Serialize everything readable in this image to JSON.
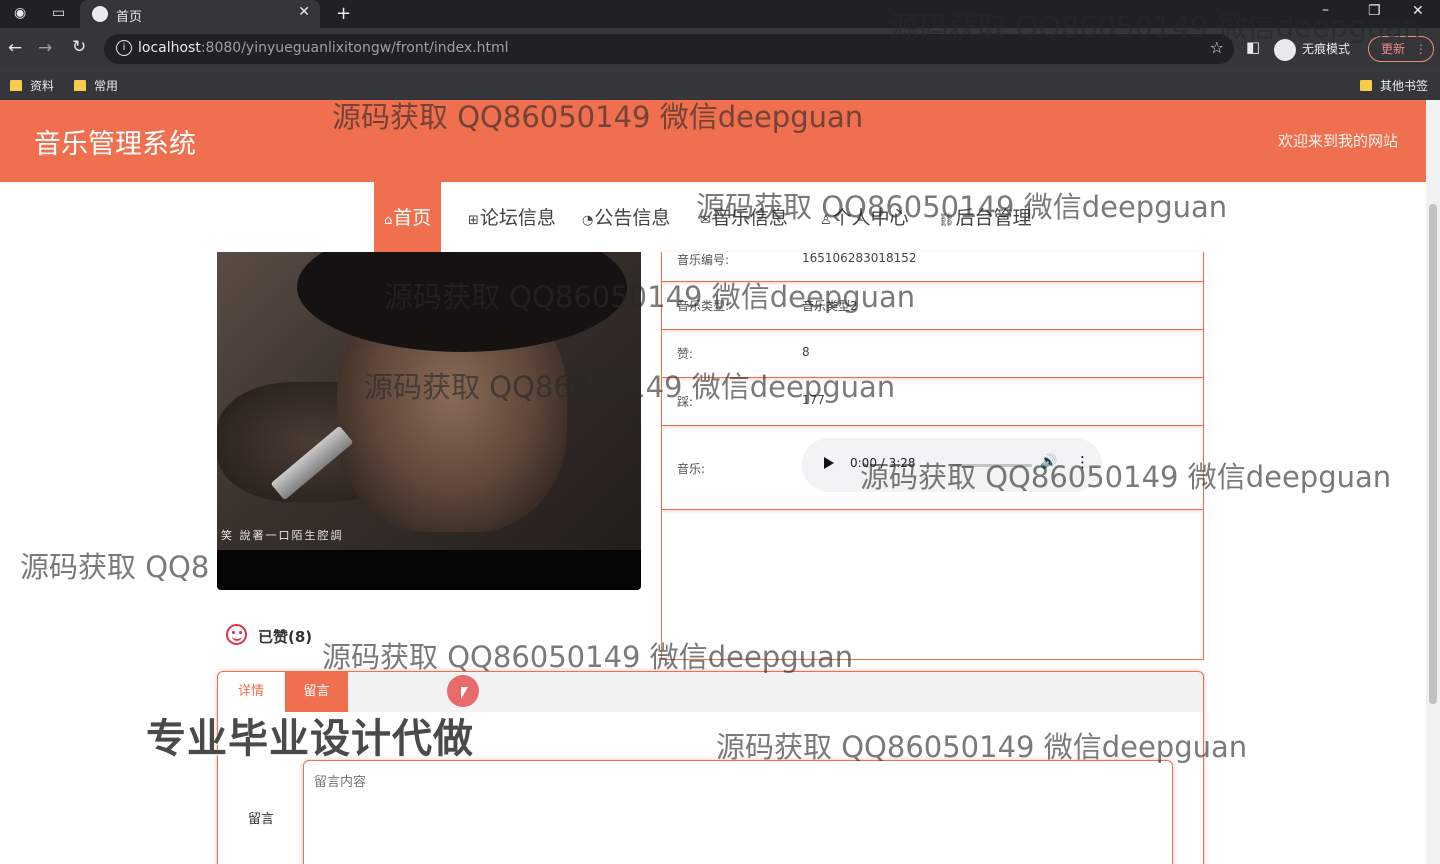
{
  "browser": {
    "tab_title": "首页",
    "url_host": "localhost",
    "url_rest": ":8080/yinyueguanlixitongw/front/index.html",
    "incognito_label": "无痕模式",
    "update_label": "更新",
    "bookmarks": [
      "资料",
      "常用"
    ],
    "other_bookmarks": "其他书签"
  },
  "site": {
    "title": "音乐管理系统",
    "welcome": "欢迎来到我的网站"
  },
  "nav": [
    {
      "label": "首页",
      "icon": "home-icon",
      "active": true
    },
    {
      "label": "论坛信息",
      "icon": "grid-icon"
    },
    {
      "label": "公告信息",
      "icon": "gauge-icon"
    },
    {
      "label": "音乐信息",
      "icon": "mail-icon"
    },
    {
      "label": "个人中心",
      "icon": "user-icon"
    },
    {
      "label": "后台管理",
      "icon": "link-icon"
    }
  ],
  "cover": {
    "subtitle": "笑 說著一口陌生腔調"
  },
  "info": {
    "rows": [
      {
        "label": "音乐编号:",
        "value": "165106283018152"
      },
      {
        "label": "音乐类型:",
        "value": "音乐类型2"
      },
      {
        "label": "赞:",
        "value": "8"
      },
      {
        "label": "踩:",
        "value": "177"
      }
    ],
    "audio_label": "音乐:",
    "audio_time": "0:00 / 3:28"
  },
  "like": {
    "label": "已赞(8)"
  },
  "detail": {
    "tabs": [
      "详情",
      "留言"
    ],
    "comment_label": "留言",
    "comment_placeholder": "留言内容"
  },
  "overlay": {
    "watermark": "源码获取 QQ86050149 微信deepguan",
    "watermark_partial": "源码获取 QQ8",
    "watermark_top": "源码获取 QQ86050149 微信deepguan",
    "promo": "专业毕业设计代做"
  },
  "colors": {
    "accent": "#ef6f4f",
    "like": "#e0304a"
  }
}
